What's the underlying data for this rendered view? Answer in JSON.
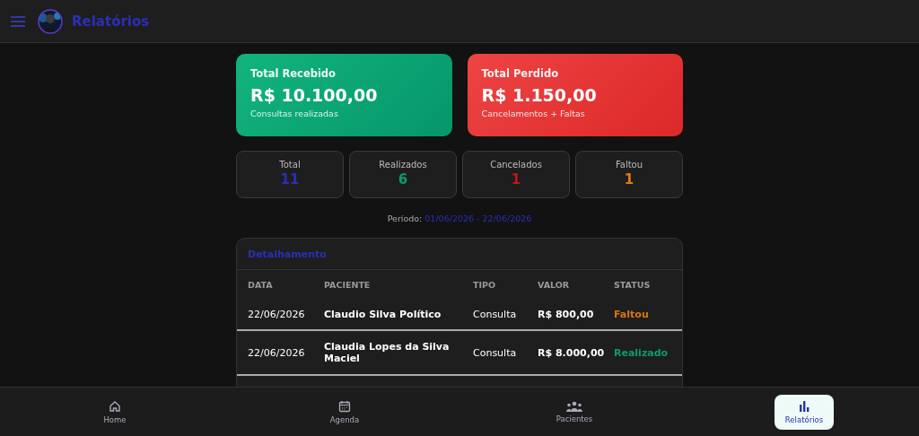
{
  "header": {
    "title": "Relatórios"
  },
  "summary": [
    {
      "kind": "gain",
      "title": "Total Recebido",
      "amount": "R$ 10.100,00",
      "caption": "Consultas realizadas"
    },
    {
      "kind": "loss",
      "title": "Total Perdido",
      "amount": "R$ 1.150,00",
      "caption": "Cancelamentos + Faltas"
    }
  ],
  "stats": [
    {
      "label": "Total",
      "value": "11",
      "color": "#2a2fb8"
    },
    {
      "label": "Realizados",
      "value": "6",
      "color": "#0e9a6a"
    },
    {
      "label": "Cancelados",
      "value": "1",
      "color": "#c0161c"
    },
    {
      "label": "Faltou",
      "value": "1",
      "color": "#e07d10"
    }
  ],
  "period": {
    "label": "Período:",
    "range": "01/06/2026 - 22/06/2026"
  },
  "table": {
    "title": "Detalhamento",
    "columns": [
      "DATA",
      "PACIENTE",
      "TIPO",
      "VALOR",
      "STATUS"
    ],
    "rows": [
      {
        "date": "22/06/2026",
        "patient": "Claudio Silva Político",
        "type": "Consulta",
        "value": "R$ 800,00",
        "status": "Faltou",
        "color": "#d9740e"
      },
      {
        "date": "22/06/2026",
        "patient": "Claudia Lopes da Silva Maciel",
        "type": "Consulta",
        "value": "R$ 8.000,00",
        "status": "Realizado",
        "color": "#0e9a6a"
      }
    ]
  },
  "nav": [
    {
      "kind": "home",
      "label": "Home",
      "selected": false
    },
    {
      "kind": "calendar",
      "label": "Agenda",
      "selected": false
    },
    {
      "kind": "people",
      "label": "Pacientes",
      "selected": false
    },
    {
      "kind": "chart",
      "label": "Relatórios",
      "selected": true
    }
  ]
}
